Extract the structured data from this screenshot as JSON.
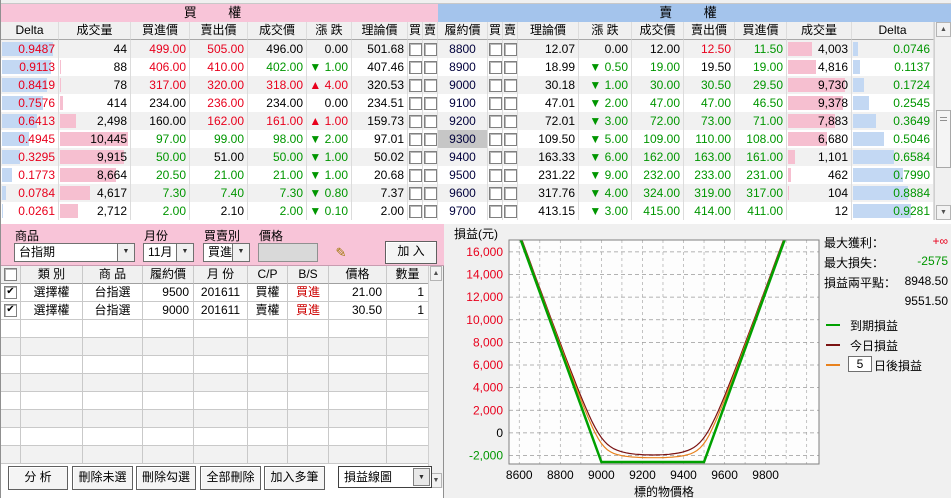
{
  "quote": {
    "call_title": "買 權",
    "put_title": "賣 權",
    "call_cols": [
      "Delta",
      "成交量",
      "買進價",
      "賣出價",
      "成交價",
      "漲  跌",
      "理論價",
      "買",
      "賣"
    ],
    "strike_col": "履約價",
    "put_cols": [
      "買",
      "賣",
      "理論價",
      "漲  跌",
      "成交價",
      "賣出價",
      "買進價",
      "成交量",
      "Delta"
    ],
    "vol_scale_max": 10500,
    "rows": [
      {
        "strike": "8800",
        "hl": false,
        "call": {
          "delta": "0.9487",
          "delta_n": 0.9487,
          "vol": "44",
          "vol_n": 44,
          "bid": "499.00",
          "bid_c": "r",
          "ask": "505.00",
          "ask_c": "r",
          "last": "496.00",
          "last_c": "k",
          "chg": "0.00",
          "dir": "flat",
          "chg_c": "k",
          "theo": "501.68"
        },
        "put": {
          "theo": "12.07",
          "chg": "0.00",
          "dir": "flat",
          "chg_c": "k",
          "last": "12.00",
          "last_c": "k",
          "ask": "12.50",
          "ask_c": "r",
          "bid": "11.50",
          "bid_c": "g",
          "vol": "4,003",
          "vol_n": 4003,
          "delta": "0.0746",
          "delta_n": 0.0746
        }
      },
      {
        "strike": "8900",
        "hl": false,
        "call": {
          "delta": "0.9113",
          "delta_n": 0.9113,
          "vol": "88",
          "vol_n": 88,
          "bid": "406.00",
          "bid_c": "r",
          "ask": "410.00",
          "ask_c": "r",
          "last": "402.00",
          "last_c": "g",
          "chg": "1.00",
          "dir": "down",
          "chg_c": "g",
          "theo": "407.46"
        },
        "put": {
          "theo": "18.99",
          "chg": "0.50",
          "dir": "down",
          "chg_c": "g",
          "last": "19.00",
          "last_c": "g",
          "ask": "19.50",
          "ask_c": "k",
          "bid": "19.00",
          "bid_c": "g",
          "vol": "4,816",
          "vol_n": 4816,
          "delta": "0.1137",
          "delta_n": 0.1137
        }
      },
      {
        "strike": "9000",
        "hl": false,
        "call": {
          "delta": "0.8419",
          "delta_n": 0.8419,
          "vol": "78",
          "vol_n": 78,
          "bid": "317.00",
          "bid_c": "r",
          "ask": "320.00",
          "ask_c": "r",
          "last": "318.00",
          "last_c": "r",
          "chg": "4.00",
          "dir": "up",
          "chg_c": "r",
          "theo": "320.53"
        },
        "put": {
          "theo": "30.18",
          "chg": "1.00",
          "dir": "down",
          "chg_c": "g",
          "last": "30.00",
          "last_c": "g",
          "ask": "30.50",
          "ask_c": "g",
          "bid": "29.50",
          "bid_c": "g",
          "vol": "9,730",
          "vol_n": 9730,
          "delta": "0.1724",
          "delta_n": 0.1724
        }
      },
      {
        "strike": "9100",
        "hl": false,
        "call": {
          "delta": "0.7576",
          "delta_n": 0.7576,
          "vol": "414",
          "vol_n": 414,
          "bid": "234.00",
          "bid_c": "k",
          "ask": "236.00",
          "ask_c": "r",
          "last": "234.00",
          "last_c": "k",
          "chg": "0.00",
          "dir": "flat",
          "chg_c": "k",
          "theo": "234.51"
        },
        "put": {
          "theo": "47.01",
          "chg": "2.00",
          "dir": "down",
          "chg_c": "g",
          "last": "47.00",
          "last_c": "g",
          "ask": "47.00",
          "ask_c": "g",
          "bid": "46.50",
          "bid_c": "g",
          "vol": "9,378",
          "vol_n": 9378,
          "delta": "0.2545",
          "delta_n": 0.2545
        }
      },
      {
        "strike": "9200",
        "hl": false,
        "call": {
          "delta": "0.6413",
          "delta_n": 0.6413,
          "vol": "2,498",
          "vol_n": 2498,
          "bid": "160.00",
          "bid_c": "k",
          "ask": "162.00",
          "ask_c": "r",
          "last": "161.00",
          "last_c": "r",
          "chg": "1.00",
          "dir": "up",
          "chg_c": "r",
          "theo": "159.73"
        },
        "put": {
          "theo": "72.01",
          "chg": "3.00",
          "dir": "down",
          "chg_c": "g",
          "last": "72.00",
          "last_c": "g",
          "ask": "73.00",
          "ask_c": "g",
          "bid": "71.00",
          "bid_c": "g",
          "vol": "7,883",
          "vol_n": 7883,
          "delta": "0.3649",
          "delta_n": 0.3649
        }
      },
      {
        "strike": "9300",
        "hl": true,
        "call": {
          "delta": "0.4945",
          "delta_n": 0.4945,
          "vol": "10,445",
          "vol_n": 10445,
          "bid": "97.00",
          "bid_c": "g",
          "ask": "99.00",
          "ask_c": "g",
          "last": "98.00",
          "last_c": "g",
          "chg": "2.00",
          "dir": "down",
          "chg_c": "g",
          "theo": "97.01"
        },
        "put": {
          "theo": "109.50",
          "chg": "5.00",
          "dir": "down",
          "chg_c": "g",
          "last": "109.00",
          "last_c": "g",
          "ask": "110.00",
          "ask_c": "g",
          "bid": "108.00",
          "bid_c": "g",
          "vol": "6,680",
          "vol_n": 6680,
          "delta": "0.5046",
          "delta_n": 0.5046
        }
      },
      {
        "strike": "9400",
        "hl": false,
        "call": {
          "delta": "0.3295",
          "delta_n": 0.3295,
          "vol": "9,915",
          "vol_n": 9915,
          "bid": "50.00",
          "bid_c": "g",
          "ask": "51.00",
          "ask_c": "k",
          "last": "50.00",
          "last_c": "g",
          "chg": "1.00",
          "dir": "down",
          "chg_c": "g",
          "theo": "50.02"
        },
        "put": {
          "theo": "163.33",
          "chg": "6.00",
          "dir": "down",
          "chg_c": "g",
          "last": "162.00",
          "last_c": "g",
          "ask": "163.00",
          "ask_c": "g",
          "bid": "161.00",
          "bid_c": "g",
          "vol": "1,101",
          "vol_n": 1101,
          "delta": "0.6584",
          "delta_n": 0.6584
        }
      },
      {
        "strike": "9500",
        "hl": false,
        "call": {
          "delta": "0.1773",
          "delta_n": 0.1773,
          "vol": "8,664",
          "vol_n": 8664,
          "bid": "20.50",
          "bid_c": "g",
          "ask": "21.00",
          "ask_c": "g",
          "last": "21.00",
          "last_c": "g",
          "chg": "1.00",
          "dir": "down",
          "chg_c": "g",
          "theo": "20.68"
        },
        "put": {
          "theo": "231.22",
          "chg": "9.00",
          "dir": "down",
          "chg_c": "g",
          "last": "232.00",
          "last_c": "g",
          "ask": "233.00",
          "ask_c": "g",
          "bid": "231.00",
          "bid_c": "g",
          "vol": "462",
          "vol_n": 462,
          "delta": "0.7990",
          "delta_n": 0.799
        }
      },
      {
        "strike": "9600",
        "hl": false,
        "call": {
          "delta": "0.0784",
          "delta_n": 0.0784,
          "vol": "4,617",
          "vol_n": 4617,
          "bid": "7.30",
          "bid_c": "g",
          "ask": "7.40",
          "ask_c": "g",
          "last": "7.30",
          "last_c": "g",
          "chg": "0.80",
          "dir": "down",
          "chg_c": "g",
          "theo": "7.37"
        },
        "put": {
          "theo": "317.76",
          "chg": "4.00",
          "dir": "down",
          "chg_c": "g",
          "last": "324.00",
          "last_c": "g",
          "ask": "319.00",
          "ask_c": "g",
          "bid": "317.00",
          "bid_c": "g",
          "vol": "104",
          "vol_n": 104,
          "delta": "0.8884",
          "delta_n": 0.8884
        }
      },
      {
        "strike": "9700",
        "hl": false,
        "call": {
          "delta": "0.0261",
          "delta_n": 0.0261,
          "vol": "2,712",
          "vol_n": 2712,
          "bid": "2.00",
          "bid_c": "g",
          "ask": "2.10",
          "ask_c": "k",
          "last": "2.00",
          "last_c": "g",
          "chg": "0.10",
          "dir": "down",
          "chg_c": "g",
          "theo": "2.00"
        },
        "put": {
          "theo": "413.15",
          "chg": "3.00",
          "dir": "down",
          "chg_c": "g",
          "last": "415.00",
          "last_c": "g",
          "ask": "414.00",
          "ask_c": "g",
          "bid": "411.00",
          "bid_c": "g",
          "vol": "12",
          "vol_n": 12,
          "delta": "0.9281",
          "delta_n": 0.9281
        }
      }
    ]
  },
  "order_form": {
    "labels": {
      "product": "商品",
      "month": "月份",
      "side": "買賣別",
      "price": "價格"
    },
    "product_value": "台指期",
    "month_value": "11月",
    "side_value": "買進",
    "price_value": "",
    "add_label": "加 入"
  },
  "order_table": {
    "cols": [
      "類  別",
      "商  品",
      "履約價",
      "月  份",
      "C/P",
      "B/S",
      "價格",
      "數量"
    ],
    "rows": [
      {
        "checked": true,
        "cat": "選擇權",
        "prod": "台指選",
        "strike": "9500",
        "month": "201611",
        "cp": "買權",
        "bs": "買進",
        "price": "21.00",
        "qty": "1"
      },
      {
        "checked": true,
        "cat": "選擇權",
        "prod": "台指選",
        "strike": "9000",
        "month": "201611",
        "cp": "賣權",
        "bs": "買進",
        "price": "30.50",
        "qty": "1"
      }
    ],
    "empty_row_count": 8
  },
  "actions": {
    "analyze": "分 析",
    "del_unselected": "刪除未選",
    "del_checked": "刪除勾選",
    "del_all": "全部刪除",
    "add_multi": "加入多筆",
    "view_select": "損益線圖"
  },
  "chart_data": {
    "type": "line",
    "ylabel": "損益(元)",
    "xlabel": "標的物價格",
    "xlim": [
      8550,
      10060
    ],
    "ylim": [
      -2750,
      17050
    ],
    "xticks": [
      8600,
      8800,
      9000,
      9200,
      9400,
      9600,
      9800
    ],
    "yticks": [
      16000,
      14000,
      12000,
      10000,
      8000,
      6000,
      4000,
      2000,
      0,
      -2000
    ],
    "grid_x_step": 100,
    "grid": true,
    "legend_position": "right",
    "series": [
      {
        "name": "到期損益",
        "kind": "payoff",
        "color": "#00a000",
        "width": 2.5,
        "put_strike": 9000,
        "call_strike": 9500,
        "flat_value": -2575,
        "slope_per_point": 50,
        "breakevens": [
          8948.5,
          9551.5
        ]
      },
      {
        "name": "今日損益",
        "kind": "smooth",
        "color": "#7a1212",
        "width": 1.2,
        "smoothing": 40,
        "min_point": [
          9250,
          -1950
        ]
      },
      {
        "name": "5 日後損益",
        "kind": "smooth",
        "color": "#e8821e",
        "width": 1.2,
        "smoothing": 31,
        "min_point": [
          9250,
          -2200
        ]
      }
    ],
    "stats": [
      {
        "label": "最大獲利：",
        "value": "+∞",
        "color": "#e8001c"
      },
      {
        "label": "最大損失：",
        "value": "-2575",
        "color": "#009600"
      },
      {
        "label": "損益兩平點：",
        "value": "8948.50",
        "color": "#000000"
      },
      {
        "label": "",
        "value": "9551.50",
        "color": "#000000"
      }
    ],
    "legend": [
      {
        "label": "到期損益",
        "color": "#00a000",
        "input": null
      },
      {
        "label": "今日損益",
        "color": "#7a1212",
        "input": null
      },
      {
        "label": "日後損益",
        "color": "#e8821e",
        "input": "5"
      }
    ]
  }
}
